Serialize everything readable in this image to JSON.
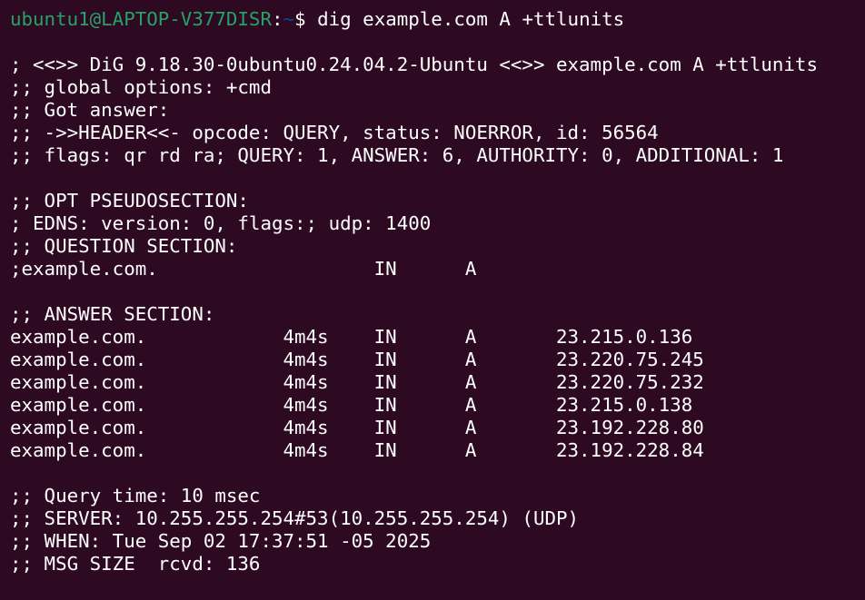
{
  "prompt": {
    "user_host": "ubuntu1@LAPTOP-V377DISR",
    "separator": ":",
    "path": "~",
    "symbol": "$ ",
    "command": "dig example.com A +ttlunits"
  },
  "output": [
    "",
    "; <<>> DiG 9.18.30-0ubuntu0.24.04.2-Ubuntu <<>> example.com A +ttlunits",
    ";; global options: +cmd",
    ";; Got answer:",
    ";; ->>HEADER<<- opcode: QUERY, status: NOERROR, id: 56564",
    ";; flags: qr rd ra; QUERY: 1, ANSWER: 6, AUTHORITY: 0, ADDITIONAL: 1",
    "",
    ";; OPT PSEUDOSECTION:",
    "; EDNS: version: 0, flags:; udp: 1400",
    ";; QUESTION SECTION:",
    ";example.com.                   IN      A",
    "",
    ";; ANSWER SECTION:",
    "example.com.            4m4s    IN      A       23.215.0.136",
    "example.com.            4m4s    IN      A       23.220.75.245",
    "example.com.            4m4s    IN      A       23.220.75.232",
    "example.com.            4m4s    IN      A       23.215.0.138",
    "example.com.            4m4s    IN      A       23.192.228.80",
    "example.com.            4m4s    IN      A       23.192.228.84",
    "",
    ";; Query time: 10 msec",
    ";; SERVER: 10.255.255.254#53(10.255.255.254) (UDP)",
    ";; WHEN: Tue Sep 02 17:37:51 -05 2025",
    ";; MSG SIZE  rcvd: 136"
  ],
  "colors": {
    "background": "#2d0922",
    "user_host": "#26a269",
    "path": "#12488b",
    "text": "#ffffff"
  }
}
